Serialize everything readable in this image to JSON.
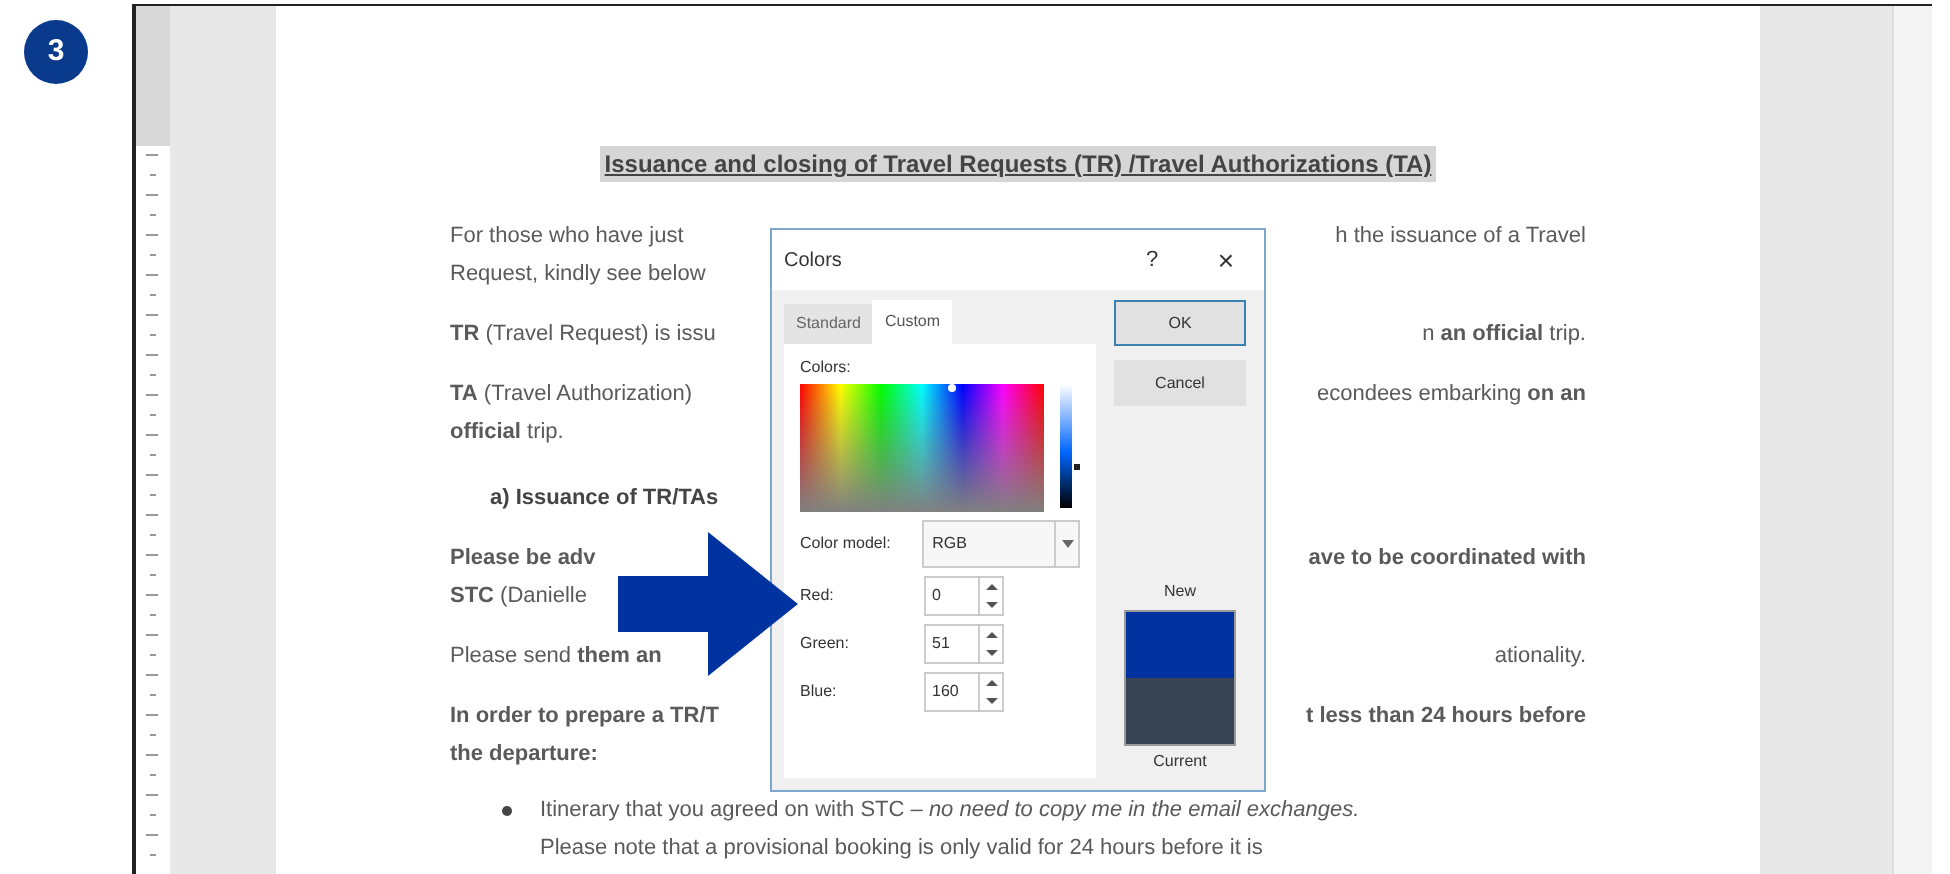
{
  "step_badge": "3",
  "document": {
    "title": "Issuance and closing of Travel Requests (TR) /Travel Authorizations (TA)",
    "paragraphs": [
      {
        "kind": "body",
        "lines": [
          {
            "left": "For those who have just",
            "right": "h the issuance of a Travel"
          },
          {
            "left": "Request, kindly see below"
          }
        ]
      },
      {
        "kind": "body",
        "lines": [
          {
            "left": "**TR** (Travel Request) is issu",
            "right": "n **an official** trip."
          }
        ]
      },
      {
        "kind": "body",
        "lines": [
          {
            "left": "**TA** (Travel Authorization)",
            "right": "econdees embarking **on an**"
          },
          {
            "left": "**official** trip."
          }
        ]
      },
      {
        "kind": "heading",
        "lines": [
          {
            "left": "a)  Issuance of TR/TAs"
          }
        ]
      },
      {
        "kind": "body",
        "lines": [
          {
            "left": "**Please be adv**",
            "right": "**ave to be coordinated with**"
          },
          {
            "left": "**STC** (Danielle"
          }
        ]
      },
      {
        "kind": "body",
        "lines": [
          {
            "left": "Please send **them an**",
            "right": "ationality."
          }
        ]
      },
      {
        "kind": "body",
        "lines": [
          {
            "left": "**In order to prepare a TR/T**",
            "right": "**t less than 24 hours before**"
          },
          {
            "left": "**the departure:**"
          }
        ]
      },
      {
        "kind": "bullet",
        "lines": [
          {
            "left": "Itinerary that you agreed on with STC – *no need to copy me in the email exchanges.*"
          },
          {
            "left": "Please note that a provisional booking is only valid for 24 hours before it is"
          }
        ]
      }
    ]
  },
  "dialog": {
    "title": "Colors",
    "help": "?",
    "close": "×",
    "tabs": [
      {
        "label": "Standard",
        "selected": false
      },
      {
        "label": "Custom",
        "selected": true
      }
    ],
    "colors_label": "Colors:",
    "color_model": {
      "label": "Color model:",
      "value": "RGB"
    },
    "channels": [
      {
        "label": "Red:",
        "value": "0"
      },
      {
        "label": "Green:",
        "value": "51"
      },
      {
        "label": "Blue:",
        "value": "160"
      }
    ],
    "buttons": [
      {
        "label": "OK",
        "default": true
      },
      {
        "label": "Cancel",
        "default": false
      }
    ],
    "swatches": [
      {
        "label": "New",
        "color": "#0033a0"
      },
      {
        "label": "Current",
        "color": "#374555"
      }
    ]
  }
}
